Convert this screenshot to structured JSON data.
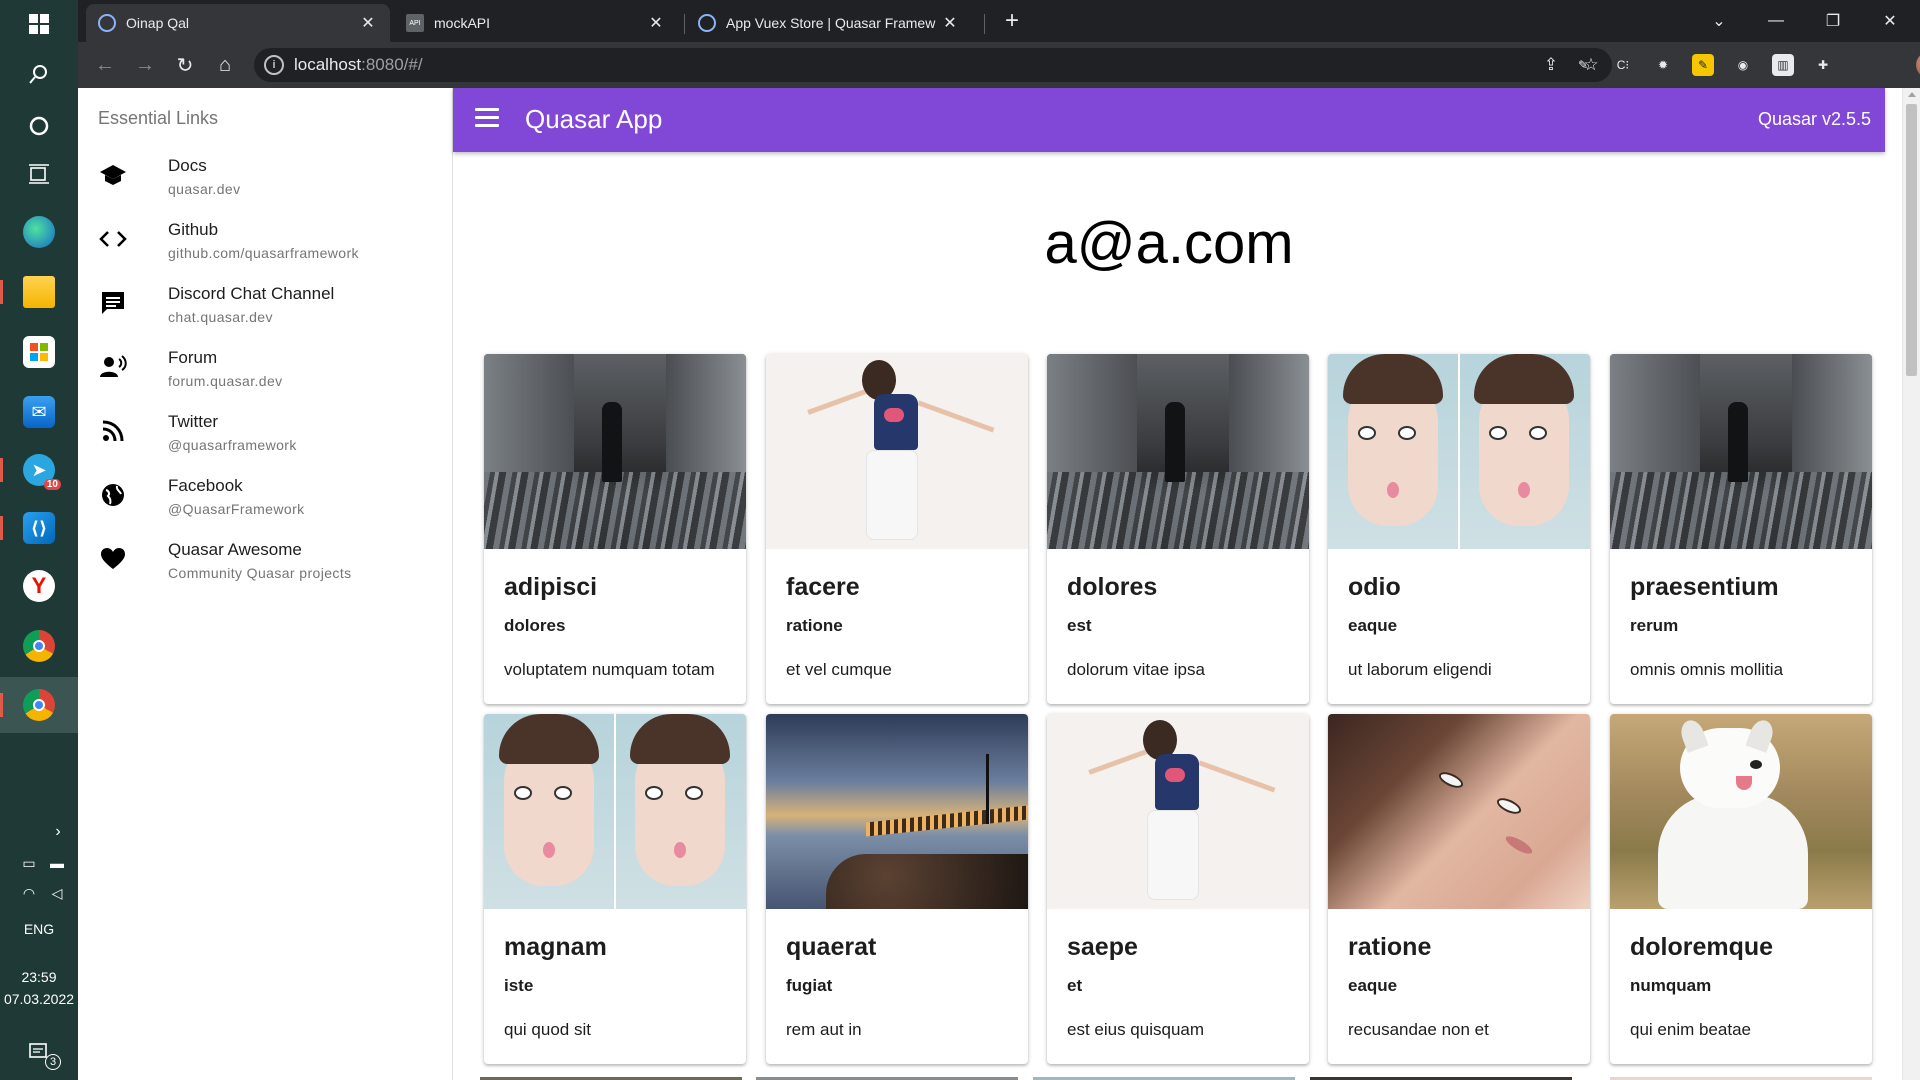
{
  "browser": {
    "tabs": [
      {
        "title": "Oinap Qal",
        "active": true
      },
      {
        "title": "mockAPI",
        "active": false,
        "favicon_text": "API"
      },
      {
        "title": "App Vuex Store | Quasar Framew",
        "active": false
      }
    ],
    "url_host": "localhost",
    "url_rest": ":8080/#/",
    "extension_icons": [
      "share-icon",
      "star-icon",
      "pen-icon",
      "css-icon",
      "bug-icon",
      "note-icon",
      "radio-icon",
      "chart-icon",
      "puzzle-icon"
    ]
  },
  "taskbar": {
    "apps": [
      "edge",
      "file-explorer",
      "microsoft-store",
      "mail",
      "telegram",
      "vscode",
      "yandex",
      "chrome",
      "chrome-profile"
    ],
    "telegram_badge": "10",
    "language": "ENG",
    "time": "23:59",
    "date": "07.03.2022",
    "notifications": "3"
  },
  "drawer": {
    "heading": "Essential Links",
    "links": [
      {
        "title": "Docs",
        "caption": "quasar.dev",
        "icon": "school-icon"
      },
      {
        "title": "Github",
        "caption": "github.com/quasarframework",
        "icon": "code-icon"
      },
      {
        "title": "Discord Chat Channel",
        "caption": "chat.quasar.dev",
        "icon": "chat-icon"
      },
      {
        "title": "Forum",
        "caption": "forum.quasar.dev",
        "icon": "record-voice-icon"
      },
      {
        "title": "Twitter",
        "caption": "@quasarframework",
        "icon": "rss-feed-icon"
      },
      {
        "title": "Facebook",
        "caption": "@QuasarFramework",
        "icon": "public-icon"
      },
      {
        "title": "Quasar Awesome",
        "caption": "Community Quasar projects",
        "icon": "favorite-icon"
      }
    ]
  },
  "header": {
    "title": "Quasar App",
    "version": "Quasar v2.5.5",
    "color": "#8148d8"
  },
  "main": {
    "user_email": "a@a.com",
    "cards": [
      {
        "title": "adipisci",
        "subtitle": "dolores",
        "text": "voluptatem numquam totam",
        "image": "tunnel"
      },
      {
        "title": "facere",
        "subtitle": "ratione",
        "text": "et vel cumque",
        "image": "jump"
      },
      {
        "title": "dolores",
        "subtitle": "est",
        "text": "dolorum vitae ipsa",
        "image": "tunnel"
      },
      {
        "title": "odio",
        "subtitle": "eaque",
        "text": "ut laborum eligendi",
        "image": "face2"
      },
      {
        "title": "praesentium",
        "subtitle": "rerum",
        "text": "omnis omnis mollitia",
        "image": "tunnel"
      },
      {
        "title": "magnam",
        "subtitle": "iste",
        "text": "qui quod sit",
        "image": "face2"
      },
      {
        "title": "quaerat",
        "subtitle": "fugiat",
        "text": "rem aut in",
        "image": "pier"
      },
      {
        "title": "saepe",
        "subtitle": "et",
        "text": "est eius quisquam",
        "image": "jump"
      },
      {
        "title": "ratione",
        "subtitle": "eaque",
        "text": "recusandae non et",
        "image": "woman"
      },
      {
        "title": "doloremque",
        "subtitle": "numquam",
        "text": "qui enim beatae",
        "image": "dog"
      }
    ]
  }
}
